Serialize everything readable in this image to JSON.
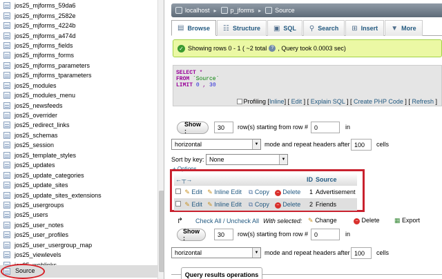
{
  "sidebar": {
    "tables": [
      "jos25_mjforms_59da6",
      "jos25_mjforms_2582e",
      "jos25_mjforms_4224b",
      "jos25_mjforms_a474d",
      "jos25_mjforms_fields",
      "jos25_mjforms_forms",
      "jos25_mjforms_parameters",
      "jos25_mjforms_tparameters",
      "jos25_modules",
      "jos25_modules_menu",
      "jos25_newsfeeds",
      "jos25_overrider",
      "jos25_redirect_links",
      "jos25_schemas",
      "jos25_session",
      "jos25_template_styles",
      "jos25_updates",
      "jos25_update_categories",
      "jos25_update_sites",
      "jos25_update_sites_extensions",
      "jos25_usergroups",
      "jos25_users",
      "jos25_user_notes",
      "jos25_user_profiles",
      "jos25_user_usergroup_map",
      "jos25_viewlevels",
      "jos25_weblinks"
    ],
    "selected": "Source"
  },
  "breadcrumb": {
    "server": "localhost",
    "database": "p_jforms",
    "table": "Source"
  },
  "tabs": {
    "browse": "Browse",
    "structure": "Structure",
    "sql": "SQL",
    "search": "Search",
    "insert": "Insert",
    "more": "More"
  },
  "message": {
    "text": "Showing rows 0 - 1 ( ~2 total",
    "text2": ", Query took 0.0003 sec)"
  },
  "sql": {
    "line1_kw": "SELECT",
    "line1_rest": " *",
    "line2_kw": "FROM",
    "line2_rest": " `Source`",
    "line3_kw": "LIMIT",
    "line3_a": " 0",
    "line3_b": " , ",
    "line3_c": "30"
  },
  "sql_links": {
    "profiling": "Profiling",
    "inline": "Inline",
    "edit": "Edit",
    "explain": "Explain SQL",
    "create_php": "Create PHP Code",
    "refresh": "Refresh"
  },
  "nav": {
    "show_label": "Show :",
    "rows_value": "30",
    "rows_text": "row(s) starting from row #",
    "start_value": "0",
    "in_text": "in",
    "mode_value": "horizontal",
    "mode_text": "mode and repeat headers after",
    "headers_value": "100",
    "cells_text": "cells",
    "sort_label": "Sort by key:",
    "sort_value": "None",
    "options_link": "+ Options"
  },
  "results": {
    "columns": [
      "ID",
      "Source"
    ],
    "actions": {
      "edit": "Edit",
      "inline_edit": "Inline Edit",
      "copy": "Copy",
      "delete": "Delete"
    },
    "rows": [
      {
        "id": "1",
        "source": "Advertisement"
      },
      {
        "id": "2",
        "source": "Friends"
      }
    ]
  },
  "bulk": {
    "check_all": "Check All / Uncheck All",
    "with_selected": "With selected:",
    "change": "Change",
    "delete": "Delete",
    "export": "Export"
  },
  "nav2": {
    "show_label": "Show :",
    "rows_value": "30",
    "rows_text": "row(s) starting from row #",
    "start_value": "0",
    "in_text": "in",
    "mode_value": "horizontal",
    "mode_text": "mode and repeat headers after",
    "headers_value": "100",
    "cells_text": "cells"
  },
  "ops_tab": "Query results operations"
}
